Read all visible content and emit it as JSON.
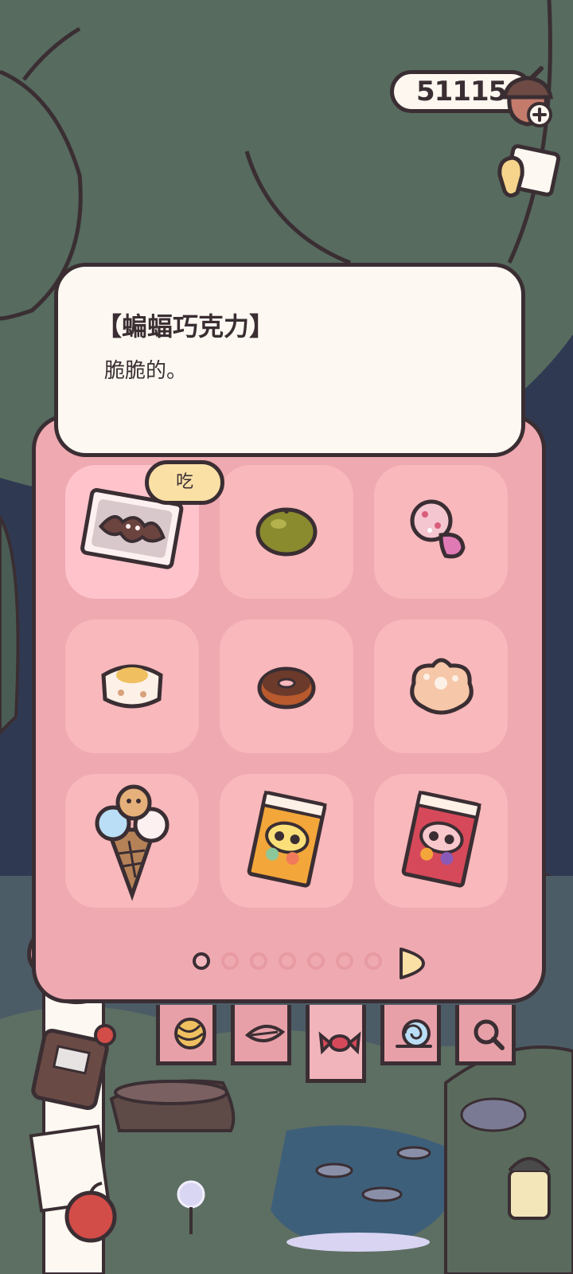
{
  "currency": {
    "amount": "51115",
    "icon": "acorn-icon",
    "add_icon": "plus-icon"
  },
  "memo_icon": "memo-icon",
  "item_detail": {
    "title": "【蝙蝠巧克力】",
    "description": "脆脆的。"
  },
  "eat_button": {
    "label": "吃"
  },
  "items": [
    {
      "name": "bat-chocolate-item",
      "icon": "bat-chocolate-icon",
      "selected": true
    },
    {
      "name": "green-fruit-item",
      "icon": "green-fruit-icon",
      "selected": false
    },
    {
      "name": "candy-ring-item",
      "icon": "candy-ring-icon",
      "selected": false
    },
    {
      "name": "rice-cake-item",
      "icon": "rice-cake-icon",
      "selected": false
    },
    {
      "name": "donut-item",
      "icon": "donut-icon",
      "selected": false
    },
    {
      "name": "flower-cookie-item",
      "icon": "flower-cookie-icon",
      "selected": false
    },
    {
      "name": "ice-cream-cone-item",
      "icon": "ice-cream-cone-icon",
      "selected": false
    },
    {
      "name": "orange-snack-bag-item",
      "icon": "snack-bag-icon",
      "selected": false
    },
    {
      "name": "red-snack-bag-item",
      "icon": "snack-bag-icon",
      "selected": false
    }
  ],
  "pagination": {
    "current_page": 1,
    "total_pages": 7
  },
  "category_tabs": [
    {
      "name": "tab-yarn",
      "icon": "yarn-icon",
      "active": false
    },
    {
      "name": "tab-leaf",
      "icon": "leaf-icon",
      "active": false
    },
    {
      "name": "tab-candy",
      "icon": "candy-icon",
      "active": true
    },
    {
      "name": "tab-snail",
      "icon": "snail-icon",
      "active": false
    },
    {
      "name": "tab-magnifier",
      "icon": "magnifier-icon",
      "active": false
    }
  ],
  "colors": {
    "panel": "#efa9b0",
    "slot": "#f8b8bc",
    "outline": "#3a2e33",
    "card": "#fdf9f2",
    "button": "#fbe0a6"
  }
}
